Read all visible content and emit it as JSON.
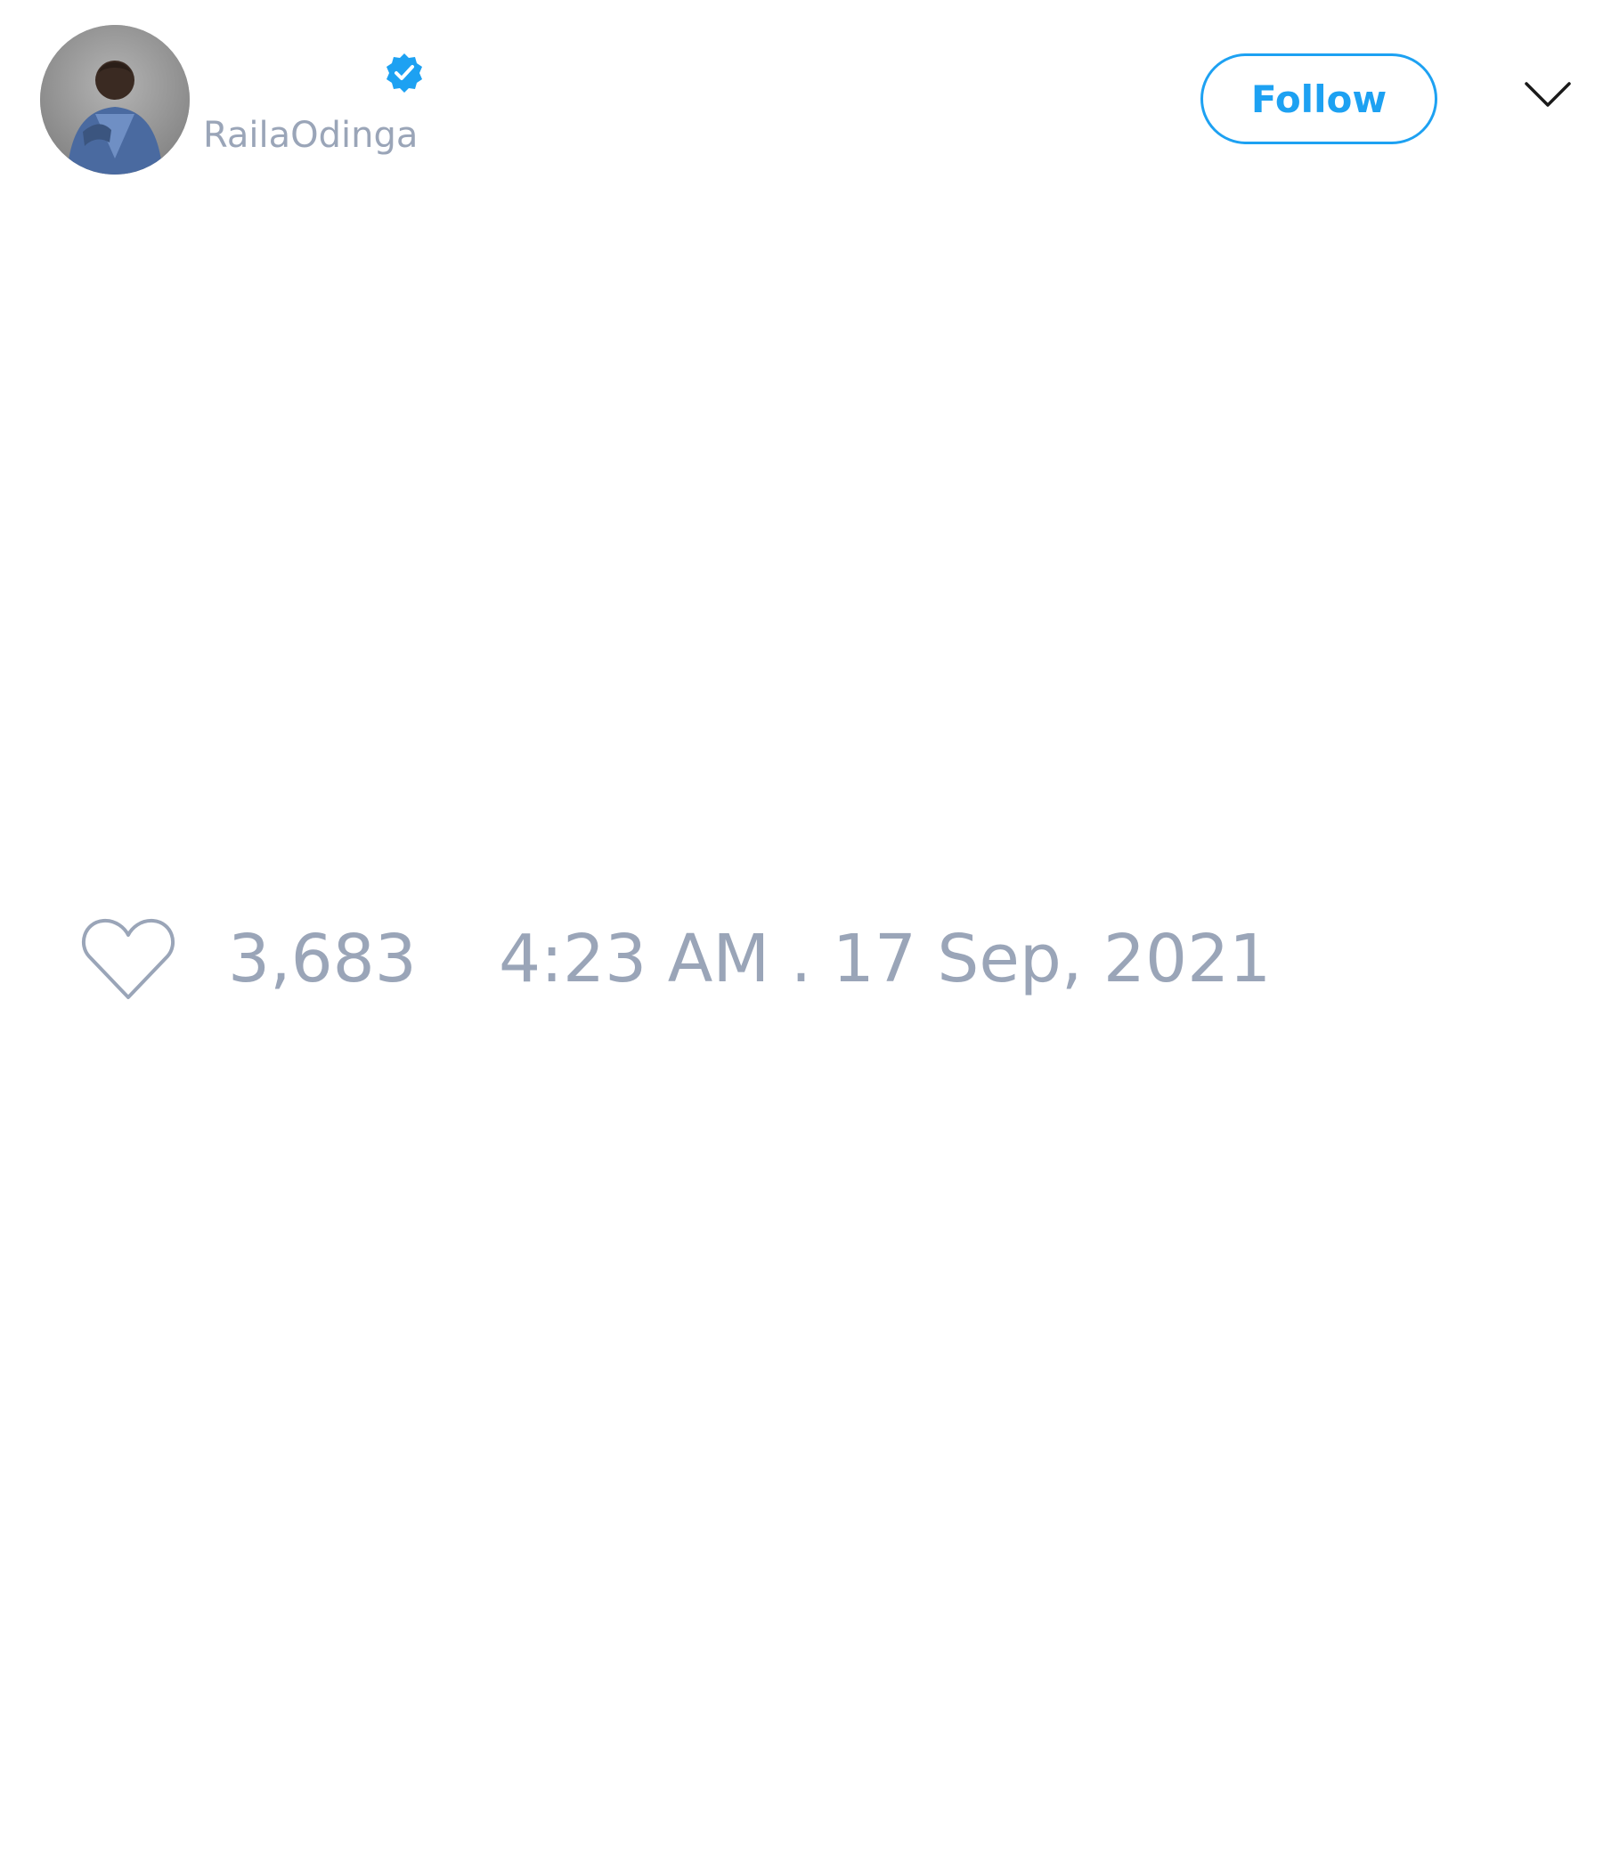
{
  "author": {
    "handle": "RailaOdinga",
    "verified": true,
    "avatar_icon": "person-avatar"
  },
  "follow_button": {
    "label": "Follow",
    "color": "#1da1f2"
  },
  "menu": {
    "icon": "chevron-down-icon"
  },
  "stats": {
    "likes_icon": "heart-outline-icon",
    "likes": "3,683",
    "timestamp": "4:23 AM . 17 Sep, 2021"
  },
  "colors": {
    "muted_text": "#9aa5b8",
    "verified_badge": "#1da1f2"
  }
}
